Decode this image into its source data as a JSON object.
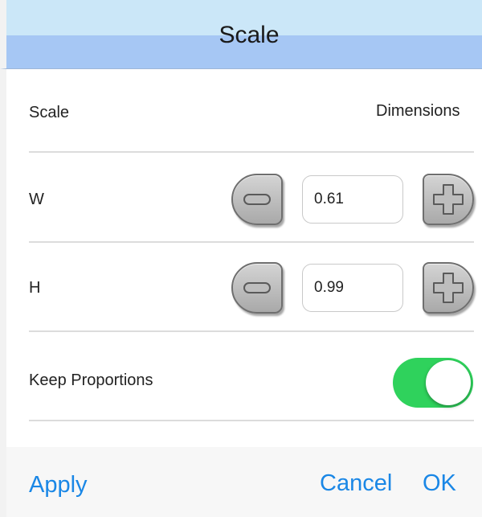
{
  "header": {
    "title": "Scale"
  },
  "section": {
    "label": "Scale",
    "mode_label": "Dimensions"
  },
  "width": {
    "label": "W",
    "value": "0.61"
  },
  "height": {
    "label": "H",
    "value": "0.99"
  },
  "keep_proportions": {
    "label": "Keep Proportions",
    "enabled": true
  },
  "footer": {
    "apply_label": "Apply",
    "cancel_label": "Cancel",
    "ok_label": "OK"
  },
  "colors": {
    "accent": "#1a87e6",
    "toggle_on": "#2fd25c",
    "header_top": "#cbe7f8",
    "header_bottom": "#a6c7f4"
  },
  "icons": {
    "decrement": "minus-icon",
    "increment": "plus-icon"
  }
}
